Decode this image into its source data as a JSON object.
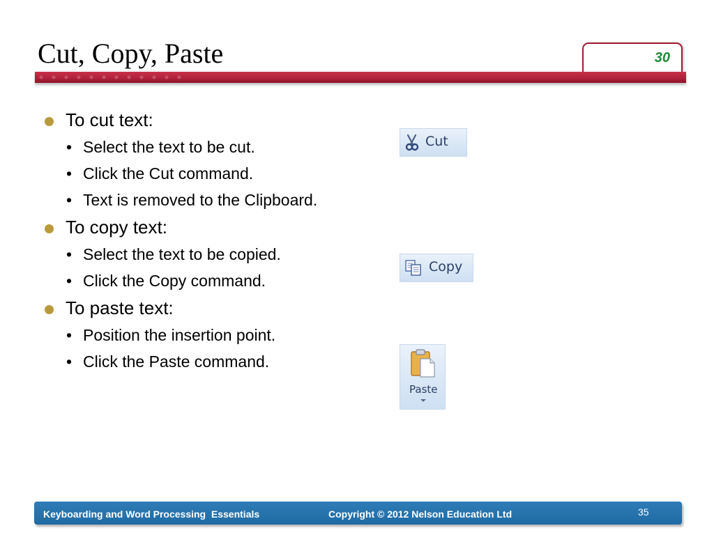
{
  "title": "Cut, Copy, Paste",
  "page_tab": "30",
  "sections": [
    {
      "heading": "To cut text:",
      "items": [
        "Select the text to be cut.",
        "Click the Cut command.",
        "Text is removed to the Clipboard."
      ]
    },
    {
      "heading": "To copy text:",
      "items": [
        "Select the text to be copied.",
        "Click the Copy command."
      ]
    },
    {
      "heading": "To paste text:",
      "items": [
        "Position the insertion point.",
        "Click the Paste command."
      ]
    }
  ],
  "commands": {
    "cut": "Cut",
    "copy": "Copy",
    "paste": "Paste"
  },
  "icons": {
    "cut": "scissors-icon",
    "copy": "copy-icon",
    "paste": "clipboard-icon"
  },
  "footer": {
    "left": "Keyboarding and Word Processing  Essentials",
    "copyright": "Copyright © 2012 Nelson Education Ltd",
    "slide_number": "35"
  },
  "colors": {
    "accent_bar": "#b0203a",
    "tab_number": "#1f8a3a",
    "bullet": "#b89a3c",
    "footer": "#1f6aa3"
  }
}
